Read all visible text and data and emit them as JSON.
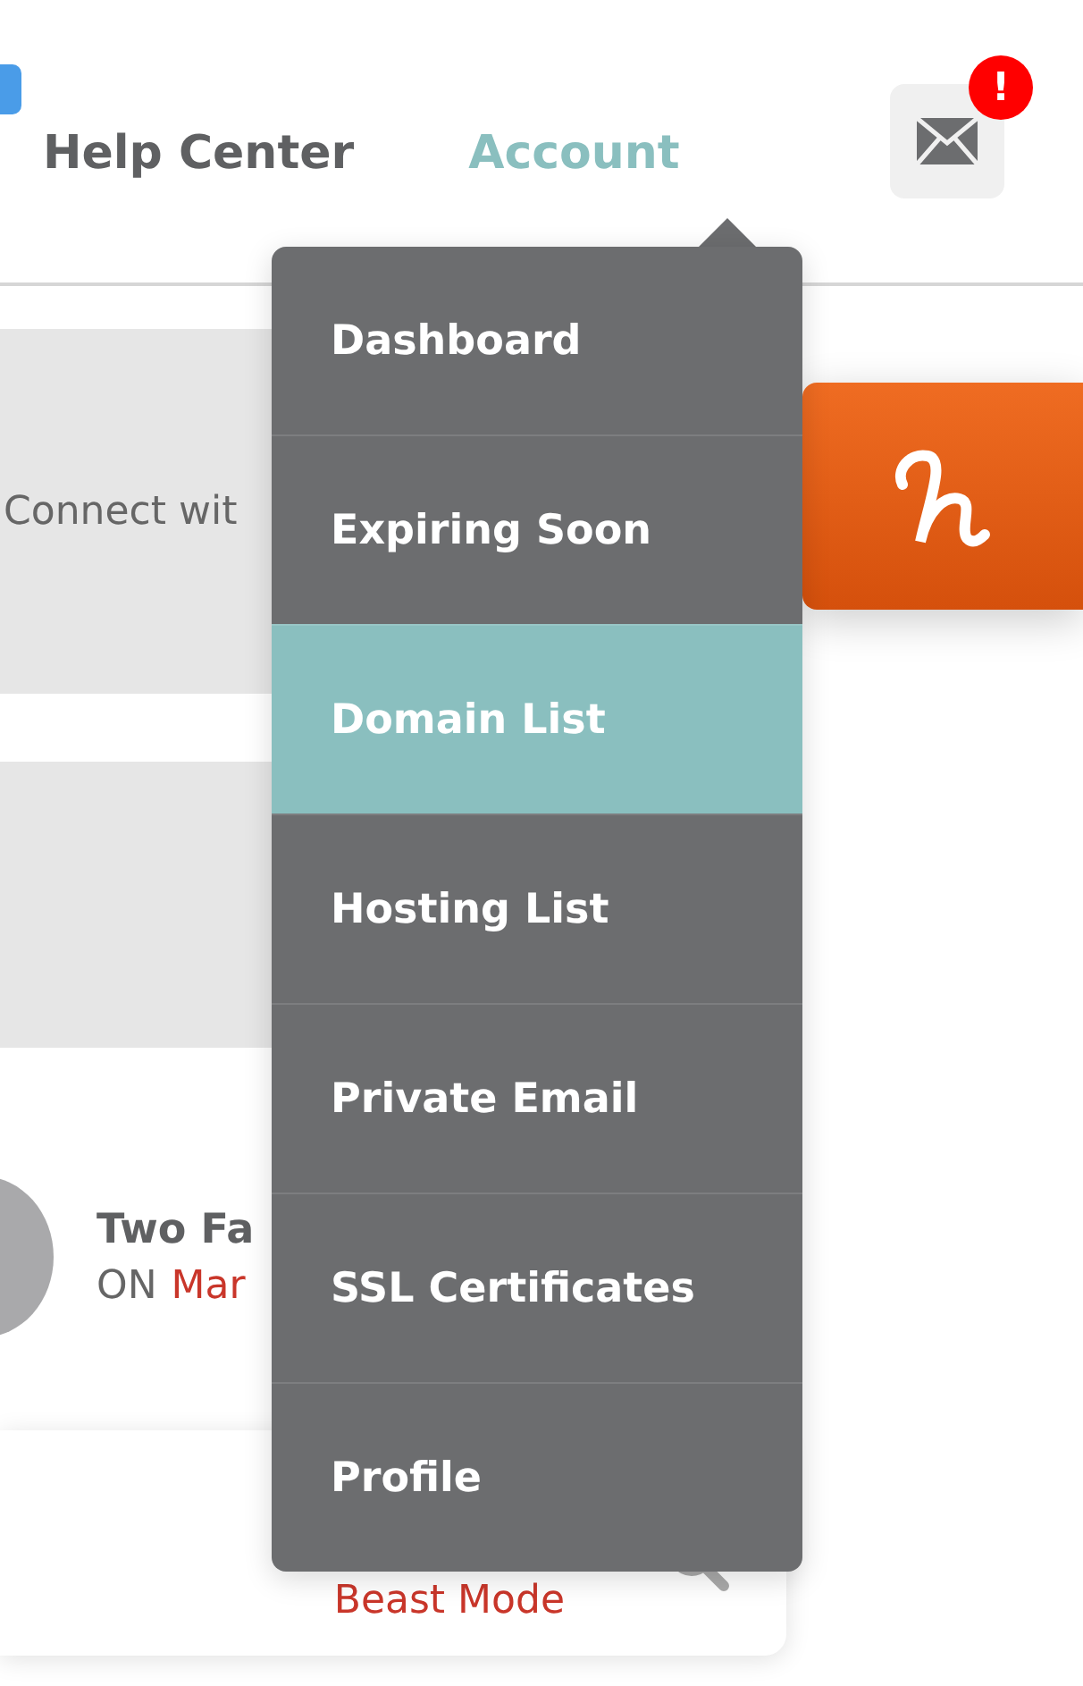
{
  "nav": {
    "items": [
      {
        "label": "Help Center",
        "selected": false
      },
      {
        "label": "Account",
        "selected": true
      }
    ],
    "mail": {
      "alert": "!"
    }
  },
  "cards": {
    "connect_text": "Connect wit",
    "two_factor": {
      "title": "Two Fa",
      "status": "ON",
      "link": "Mar"
    },
    "beast_mode": "Beast Mode"
  },
  "account_menu": [
    {
      "label": "Dashboard",
      "selected": false
    },
    {
      "label": "Expiring Soon",
      "selected": false
    },
    {
      "label": "Domain List",
      "selected": true
    },
    {
      "label": "Hosting List",
      "selected": false
    },
    {
      "label": "Private Email",
      "selected": false
    },
    {
      "label": "SSL Certificates",
      "selected": false
    },
    {
      "label": "Profile",
      "selected": false
    }
  ]
}
